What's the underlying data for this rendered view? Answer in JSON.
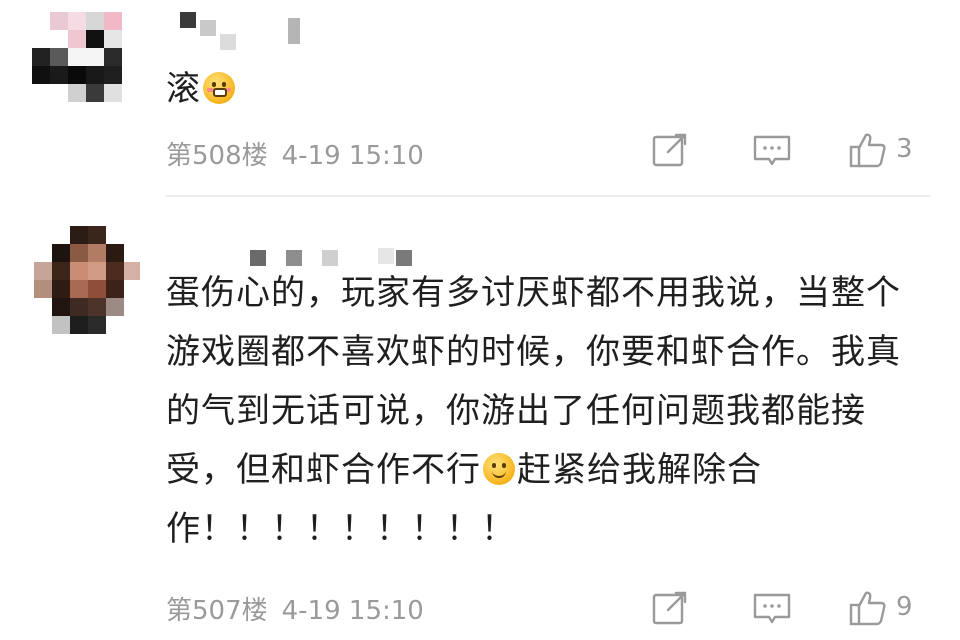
{
  "comments": [
    {
      "content_text": "滚",
      "content_emoji": "shy-smile-emoji",
      "floor": "第508楼",
      "time": "4-19 15:10",
      "like_count": "3"
    },
    {
      "content_text": "蛋伤心的，玩家有多讨厌虾都不用我说，当整个游戏圈都不喜欢虾的时候，你要和虾合作。我真的气到无话可说，你游出了任何问题我都能接受，但和虾合作不行",
      "content_emoji": "smile-emoji",
      "content_text_after": "赶紧给我解除合作！！！！！！！！！",
      "floor": "第507楼",
      "time": "4-19 15:10",
      "like_count": "9"
    }
  ],
  "icons": {
    "share": "share-icon",
    "reply": "comment-icon",
    "like": "thumbs-up-icon"
  },
  "colors": {
    "meta_text": "#9a9a9a",
    "body_text": "#1f1f1f",
    "divider": "#ececec"
  }
}
